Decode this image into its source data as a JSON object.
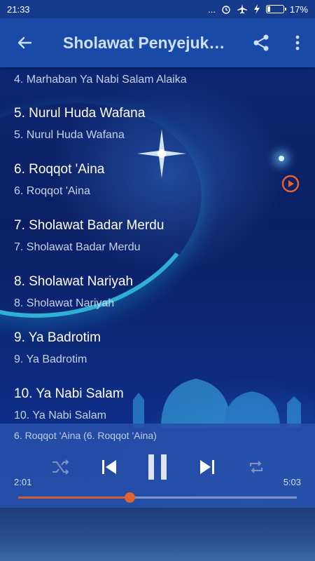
{
  "status_bar": {
    "time": "21:33",
    "dots": "...",
    "battery_percent": "17%",
    "battery_level": 0.17
  },
  "app_bar": {
    "title": "Sholawat Penyejuk…",
    "back_icon": "arrow-left-icon",
    "share_icon": "share-icon",
    "menu_icon": "more-vert-icon"
  },
  "tracks": [
    {
      "title": "4. Marhaban Ya Nabi Salam Alaika",
      "subtitle": "4. Marhaban Ya Nabi Salam Alaika",
      "partial": "top"
    },
    {
      "title": "5. Nurul Huda Wafana",
      "subtitle": "5. Nurul Huda Wafana"
    },
    {
      "title": "6. Roqqot 'Aina",
      "subtitle": "6. Roqqot 'Aina",
      "playing": true
    },
    {
      "title": "7. Sholawat Badar Merdu",
      "subtitle": "7. Sholawat Badar Merdu"
    },
    {
      "title": "8. Sholawat Nariyah",
      "subtitle": "8. Sholawat Nariyah"
    },
    {
      "title": "9. Ya Badrotim",
      "subtitle": "9. Ya Badrotim"
    },
    {
      "title": "10. Ya Nabi Salam",
      "subtitle": "10. Ya Nabi Salam"
    }
  ],
  "player": {
    "now_playing": "6. Roqqot 'Aina (6. Roqqot 'Aina)",
    "elapsed": "2:01",
    "duration": "5:03",
    "progress": 0.4,
    "accent_color": "#e0622f"
  }
}
